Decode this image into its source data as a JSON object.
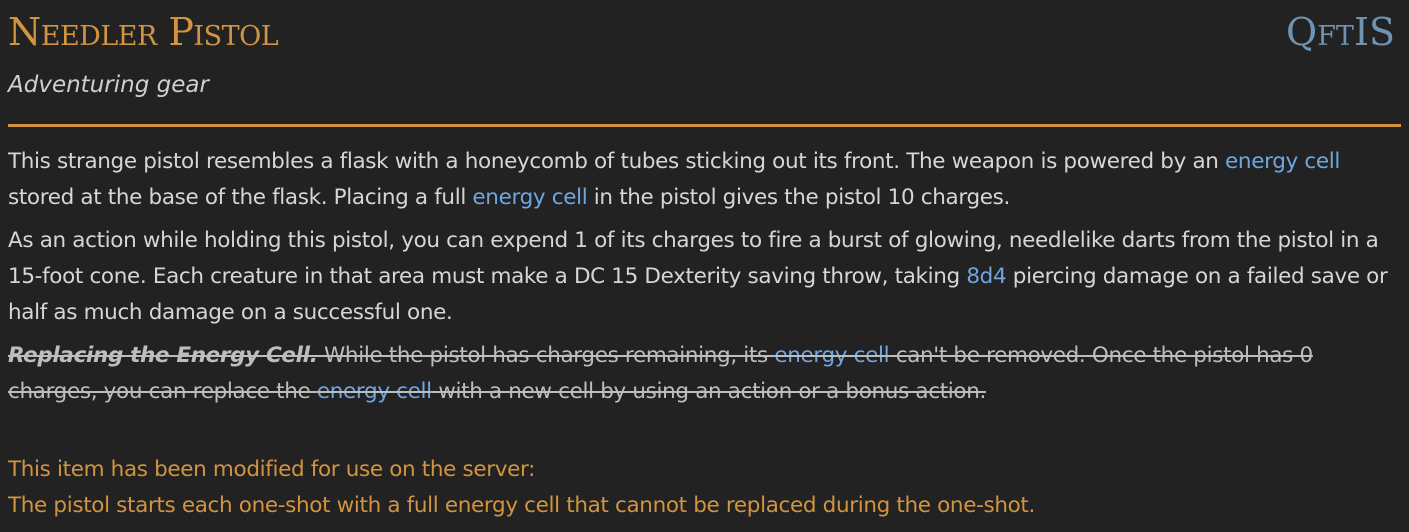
{
  "header": {
    "title": "Needler Pistol",
    "source": "QftIS",
    "subtitle": "Adventuring gear"
  },
  "body": {
    "p1": {
      "t1": "This strange pistol resembles a flask with a honeycomb of tubes sticking out its front. The weapon is powered by an ",
      "link1": "energy cell",
      "t2": " stored at the base of the flask. Placing a full ",
      "link2": "energy cell",
      "t3": " in the pistol gives the pistol 10 charges."
    },
    "p2": {
      "t1": "As an action while holding this pistol, you can expend 1 of its charges to fire a burst of glowing, needlelike darts from the pistol in a 15-foot cone. Each creature in that area must make a DC 15 Dexterity saving throw, taking ",
      "dice": "8d4",
      "t2": " piercing damage on a failed save or half as much damage on a successful one."
    },
    "p3": {
      "title": "Replacing the Energy Cell.",
      "t1": " While the pistol has charges remaining, its ",
      "link1": "energy cell",
      "t2": " can't be removed. Once the pistol has 0 charges, you can replace the ",
      "link2": "energy cell",
      "t3": " with a new cell by using an action or a bonus action."
    }
  },
  "server_note": {
    "line1": "This item has been modified for use on the server:",
    "line2": "The pistol starts each one-shot with a full energy cell that cannot be replaced during the one-shot."
  },
  "colors": {
    "background": "#222222",
    "accent": "#d2943f",
    "link": "#6fa6e2",
    "source": "#6f93b0",
    "text": "#d6d6d6"
  }
}
